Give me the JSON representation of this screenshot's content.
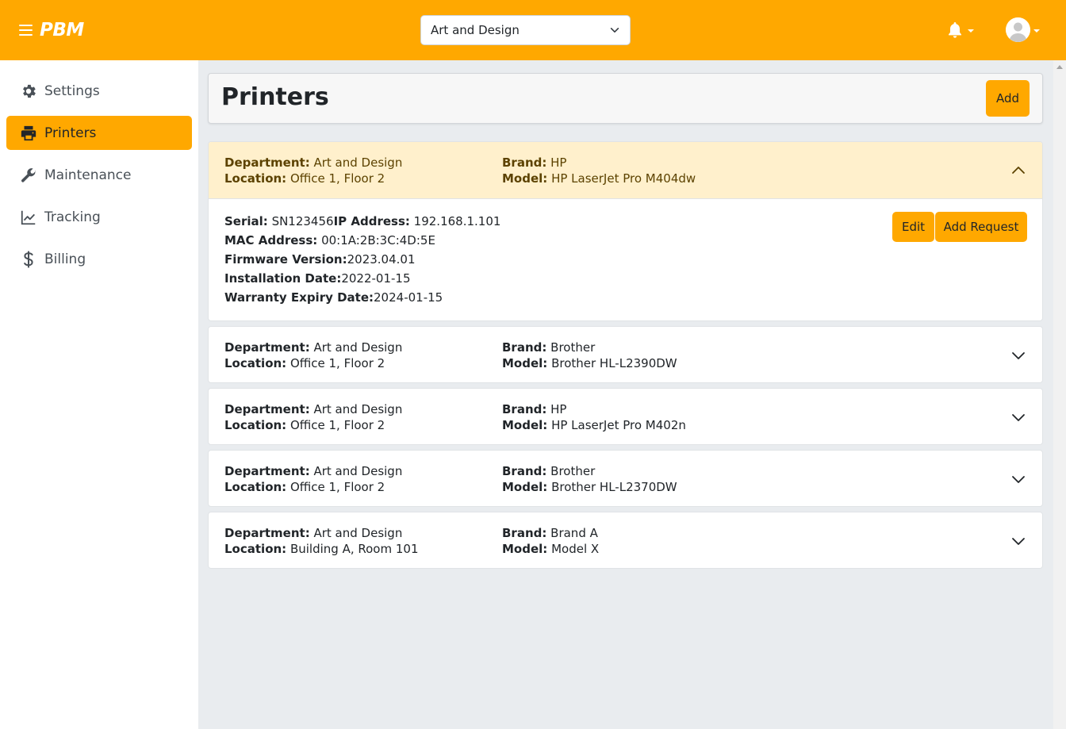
{
  "app": {
    "logo": "PBM"
  },
  "header": {
    "department_select": {
      "value": "Art and Design"
    },
    "bell_icon": "bell-icon",
    "avatar_icon": "user-avatar-icon",
    "accent_color": "#ffa800"
  },
  "sidebar": {
    "items": [
      {
        "label": "Settings",
        "icon": "gear-icon",
        "active": false
      },
      {
        "label": "Printers",
        "icon": "printer-icon",
        "active": true
      },
      {
        "label": "Maintenance",
        "icon": "wrench-icon",
        "active": false
      },
      {
        "label": "Tracking",
        "icon": "chart-line-icon",
        "active": false
      },
      {
        "label": "Billing",
        "icon": "dollar-icon",
        "active": false
      }
    ]
  },
  "main": {
    "title": "Printers",
    "add_label": "Add",
    "labels": {
      "department": "Department:",
      "location": "Location:",
      "brand": "Brand:",
      "model": "Model:",
      "serial": "Serial:",
      "ip": "IP Address:",
      "mac": "MAC Address:",
      "firmware": "Firmware Version:",
      "install": "Installation Date:",
      "warranty": "Warranty Expiry Date:"
    },
    "edit_label": "Edit",
    "add_request_label": "Add Request",
    "printers": [
      {
        "department": "Art and Design",
        "location": "Office 1, Floor 2",
        "brand": "HP",
        "model": "HP LaserJet Pro M404dw",
        "expanded": true,
        "serial": "SN123456",
        "ip": "192.168.1.101",
        "mac": "00:1A:2B:3C:4D:5E",
        "firmware": "2023.04.01",
        "install_date": "2022-01-15",
        "warranty_date": "2024-01-15"
      },
      {
        "department": "Art and Design",
        "location": "Office 1, Floor 2",
        "brand": "Brother",
        "model": "Brother HL-L2390DW",
        "expanded": false
      },
      {
        "department": "Art and Design",
        "location": "Office 1, Floor 2",
        "brand": "HP",
        "model": "HP LaserJet Pro M402n",
        "expanded": false
      },
      {
        "department": "Art and Design",
        "location": "Office 1, Floor 2",
        "brand": "Brother",
        "model": "Brother HL-L2370DW",
        "expanded": false
      },
      {
        "department": "Art and Design",
        "location": "Building A, Room 101",
        "brand": "Brand A",
        "model": "Model X",
        "expanded": false
      }
    ]
  }
}
